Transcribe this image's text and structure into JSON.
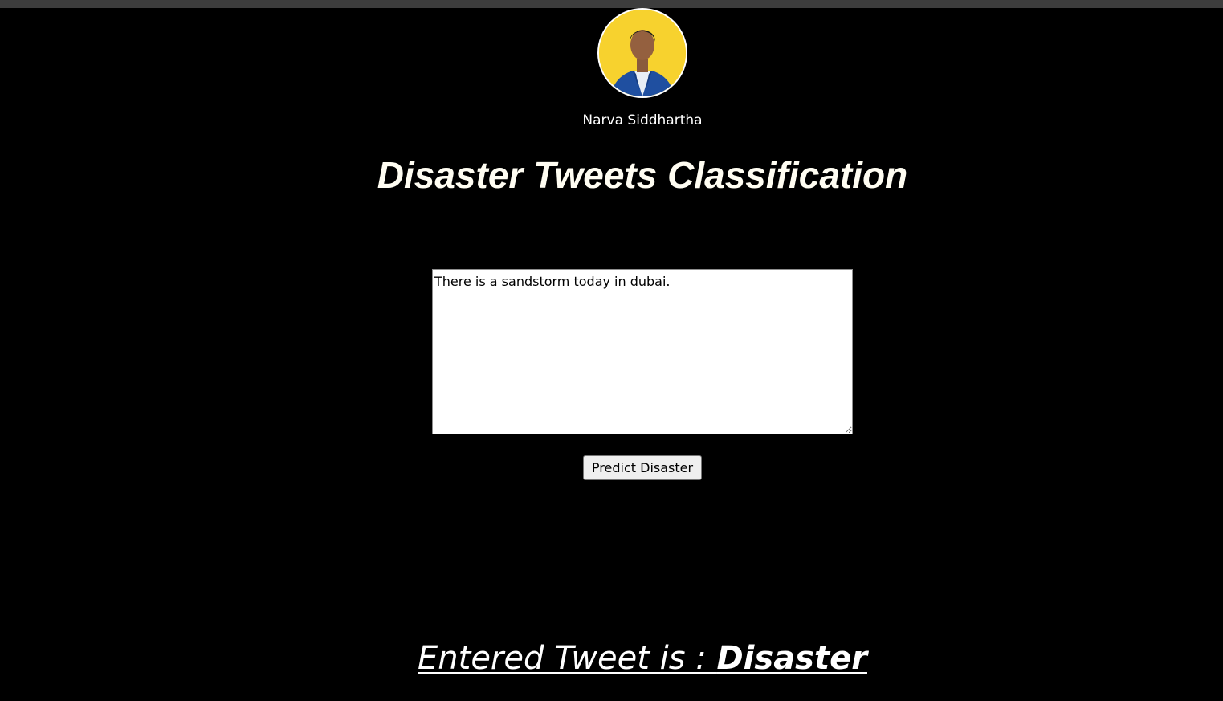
{
  "author": {
    "name": "Narva Siddhartha",
    "avatar_icon": "profile-photo"
  },
  "title": "Disaster Tweets Classification",
  "form": {
    "tweet_value": "There is a sandstorm today in dubai.",
    "predict_label": "Predict Disaster"
  },
  "result": {
    "prefix": "Entered Tweet is : ",
    "value": "Disaster"
  },
  "colors": {
    "background": "#000000",
    "avatar_background": "#f7d22e",
    "title_text": "#fffdf2"
  }
}
